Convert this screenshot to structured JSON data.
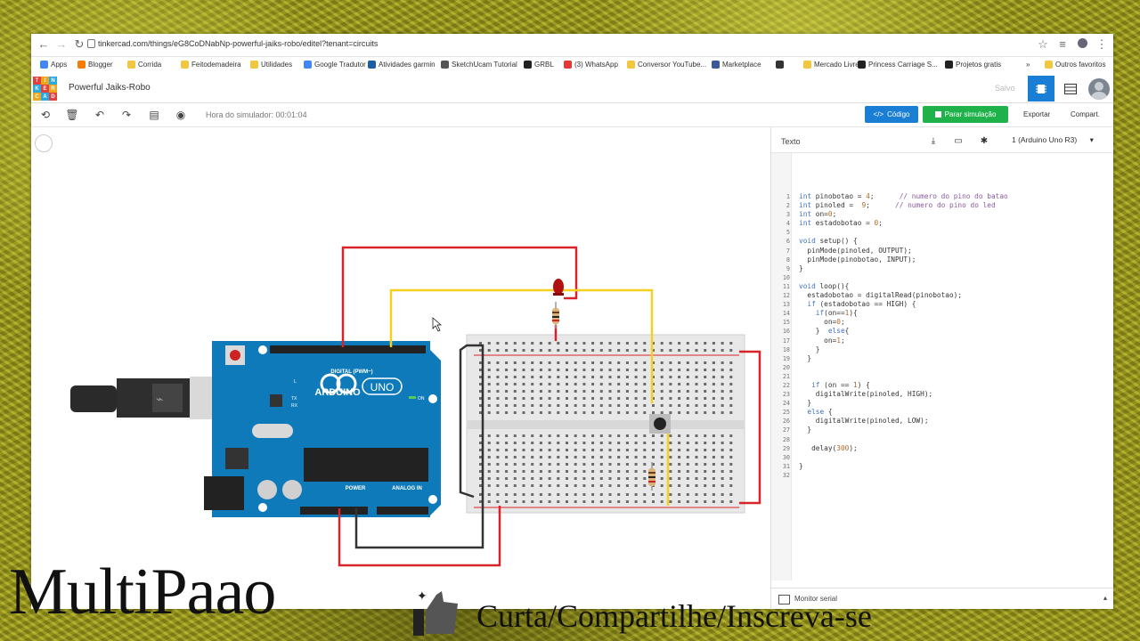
{
  "browser": {
    "url": "tinkercad.com/things/eG8CoDNabNp-powerful-jaiks-robo/editel?tenant=circuits",
    "bookmarks": [
      {
        "label": "Apps",
        "color": "#4285f4"
      },
      {
        "label": "Blogger",
        "color": "#f57d00"
      },
      {
        "label": "Corrida",
        "color": "#f3c640"
      },
      {
        "label": "Feitodemadeira",
        "color": "#f3c640"
      },
      {
        "label": "Utilidades",
        "color": "#f3c640"
      },
      {
        "label": "Google Tradutor",
        "color": "#4285f4"
      },
      {
        "label": "Atividades garmin",
        "color": "#1a5fa5"
      },
      {
        "label": "SketchUcam Tutorial",
        "color": "#555555"
      },
      {
        "label": "GRBL",
        "color": "#222222"
      },
      {
        "label": "(3) WhatsApp",
        "color": "#e53935"
      },
      {
        "label": "Conversor YouTube...",
        "color": "#f3c640"
      },
      {
        "label": "Marketplace",
        "color": "#3b5998"
      },
      {
        "label": "",
        "color": "#333333"
      },
      {
        "label": "Mercado Livre",
        "color": "#f3c640"
      },
      {
        "label": "Princess Carriage S...",
        "color": "#222222"
      },
      {
        "label": "Projetos gratis",
        "color": "#222222"
      }
    ],
    "more": "»",
    "other_bookmarks": "Outros favoritos"
  },
  "header": {
    "logo_letters": [
      "TIN",
      "KER",
      "CAD"
    ],
    "project_title": "Powerful Jaiks-Robo",
    "saved": "Salvo"
  },
  "toolbar": {
    "sim_time": "Hora do simulador: 00:01:04",
    "code_label": "Código",
    "simulate_label": "Parar simulação",
    "export_label": "Exportar",
    "share_label": "Compart."
  },
  "code_panel": {
    "mode": "Texto",
    "device": "1 (Arduino Uno R3)",
    "serial": "Monitor serial",
    "line_count": 32
  },
  "board": {
    "name": "ARDUINO",
    "model": "UNO",
    "digital": "DIGITAL (PWM~)",
    "power": "POWER",
    "analog": "ANALOG IN",
    "on": "ON",
    "tx": "TX",
    "rx": "RX",
    "l": "L"
  },
  "overlay": {
    "brand": "MultiPaao",
    "cta": "Curta/Compartilhe/Inscreva-se"
  },
  "colors": {
    "wire_red": "#d8232a",
    "wire_yellow": "#f5d020",
    "wire_black": "#333333",
    "board_blue": "#0f7ab9",
    "code_btn": "#1a7fd4",
    "sim_btn": "#20b24a"
  }
}
